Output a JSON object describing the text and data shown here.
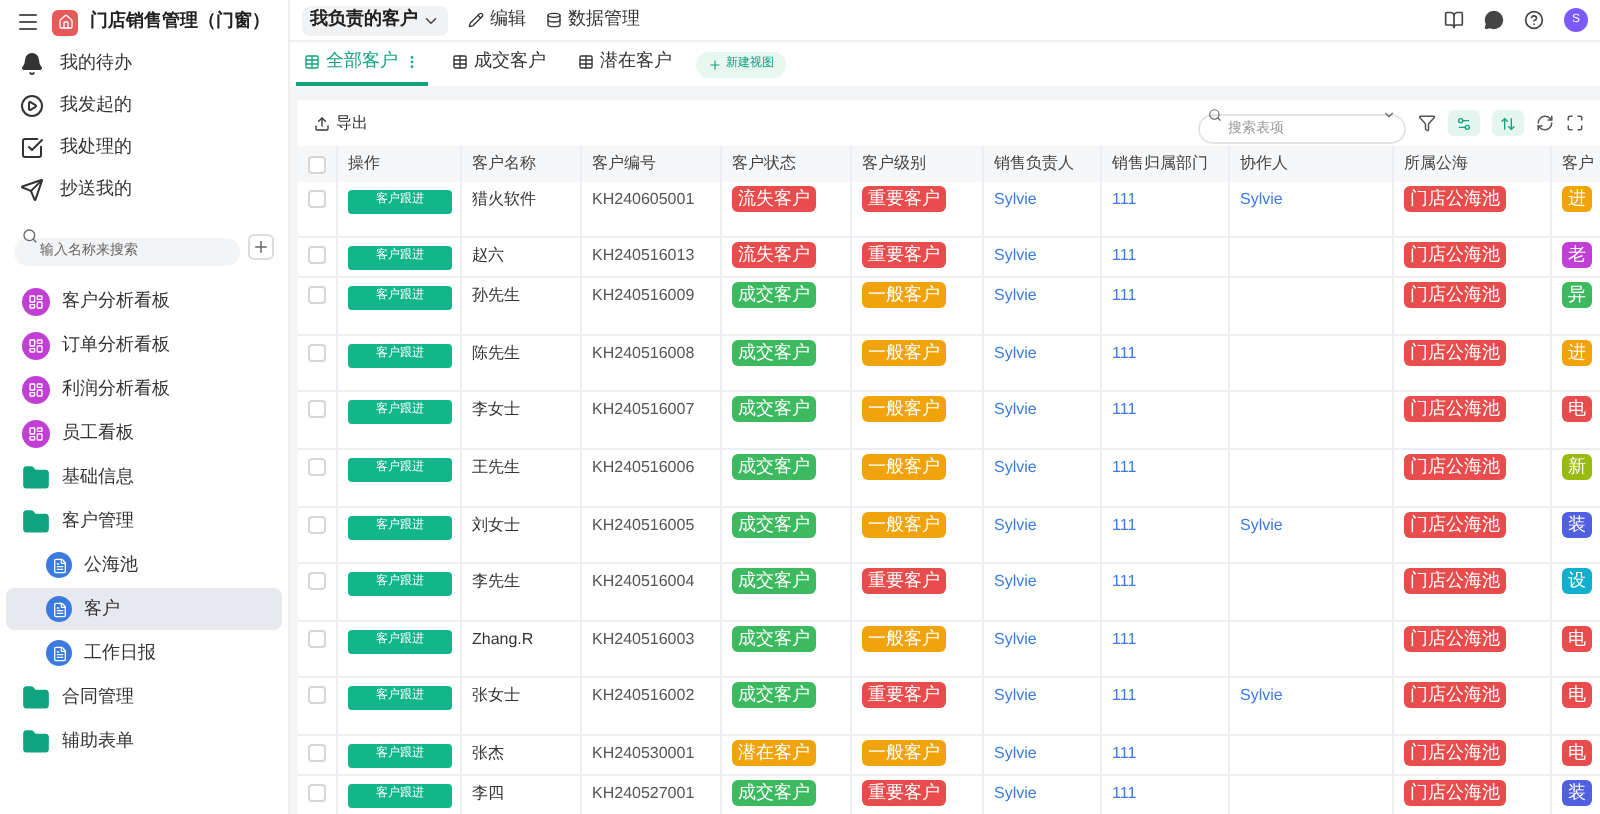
{
  "app": {
    "title": "门店销售管理（门窗）",
    "avatar": "S"
  },
  "topbar": {
    "view_select": "我负责的客户",
    "actions": [
      {
        "label": "编辑",
        "kind": "edit"
      },
      {
        "label": "数据管理",
        "kind": "data"
      }
    ]
  },
  "sidebar": {
    "shortcuts": [
      {
        "label": "我的待办",
        "kind": "bell"
      },
      {
        "label": "我发起的",
        "kind": "play"
      },
      {
        "label": "我处理的",
        "kind": "check"
      },
      {
        "label": "抄送我的",
        "kind": "send"
      }
    ],
    "search": {
      "placeholder": "输入名称来搜索"
    },
    "items": [
      {
        "label": "客户分析看板",
        "kind": "board",
        "selected": false
      },
      {
        "label": "订单分析看板",
        "kind": "board",
        "selected": false
      },
      {
        "label": "利润分析看板",
        "kind": "board",
        "selected": false
      },
      {
        "label": "员工看板",
        "kind": "board",
        "selected": false
      },
      {
        "label": "基础信息",
        "kind": "folder",
        "selected": false
      },
      {
        "label": "客户管理",
        "kind": "folder",
        "selected": false,
        "children": [
          {
            "label": "公海池",
            "kind": "form",
            "selected": false
          },
          {
            "label": "客户",
            "kind": "form",
            "selected": true
          },
          {
            "label": "工作日报",
            "kind": "form",
            "selected": false
          }
        ]
      },
      {
        "label": "合同管理",
        "kind": "folder",
        "selected": false
      },
      {
        "label": "辅助表单",
        "kind": "folder",
        "selected": false
      }
    ]
  },
  "tabs": [
    {
      "label": "全部客户",
      "selected": true
    },
    {
      "label": "成交客户",
      "selected": false
    },
    {
      "label": "潜在客户",
      "selected": false
    }
  ],
  "new_view_button": "新建视图",
  "toolbar": {
    "export": "导出",
    "search": {
      "placeholder": "搜索表项"
    }
  },
  "table": {
    "columns": [
      "操作",
      "客户名称",
      "客户编号",
      "客户状态",
      "客户级别",
      "销售负责人",
      "销售归属部门",
      "协作人",
      "所属公海",
      "客户"
    ],
    "select_all_checked": false,
    "rows": [
      {
        "action": "客户跟进",
        "name": "猎火软件",
        "code": "KH240605001",
        "status": {
          "text": "流失客户",
          "color": "#e84c4c"
        },
        "level": {
          "text": "重要客户",
          "color": "#e84c4c"
        },
        "owner": "Sylvie",
        "dept": "111",
        "collaborator": "Sylvie",
        "pool": "门店公海池",
        "source": {
          "text": "进",
          "color": "#f0a30a"
        },
        "checked": false
      },
      {
        "action": "客户跟进",
        "name": "赵六",
        "code": "KH240516013",
        "status": {
          "text": "流失客户",
          "color": "#e84c4c"
        },
        "level": {
          "text": "重要客户",
          "color": "#e84c4c"
        },
        "owner": "Sylvie",
        "dept": "111",
        "pool": "门店公海池",
        "source": {
          "text": "老",
          "color": "#c23fd6"
        },
        "checked": false
      },
      {
        "action": "客户跟进",
        "name": "孙先生",
        "code": "KH240516009",
        "status": {
          "text": "成交客户",
          "color": "#3dba5f"
        },
        "level": {
          "text": "一般客户",
          "color": "#f0a30a"
        },
        "owner": "Sylvie",
        "dept": "111",
        "pool": "门店公海池",
        "source": {
          "text": "异",
          "color": "#3dba5f"
        },
        "checked": false
      },
      {
        "action": "客户跟进",
        "name": "陈先生",
        "code": "KH240516008",
        "status": {
          "text": "成交客户",
          "color": "#3dba5f"
        },
        "level": {
          "text": "一般客户",
          "color": "#f0a30a"
        },
        "owner": "Sylvie",
        "dept": "111",
        "pool": "门店公海池",
        "source": {
          "text": "进",
          "color": "#f0a30a"
        },
        "checked": false
      },
      {
        "action": "客户跟进",
        "name": "李女士",
        "code": "KH240516007",
        "status": {
          "text": "成交客户",
          "color": "#3dba5f"
        },
        "level": {
          "text": "一般客户",
          "color": "#f0a30a"
        },
        "owner": "Sylvie",
        "dept": "111",
        "pool": "门店公海池",
        "source": {
          "text": "电",
          "color": "#e84c4c"
        },
        "checked": false
      },
      {
        "action": "客户跟进",
        "name": "王先生",
        "code": "KH240516006",
        "status": {
          "text": "成交客户",
          "color": "#3dba5f"
        },
        "level": {
          "text": "一般客户",
          "color": "#f0a30a"
        },
        "owner": "Sylvie",
        "dept": "111",
        "pool": "门店公海池",
        "source": {
          "text": "新",
          "color": "#99bb10"
        },
        "checked": false
      },
      {
        "action": "客户跟进",
        "name": "刘女士",
        "code": "KH240516005",
        "status": {
          "text": "成交客户",
          "color": "#3dba5f"
        },
        "level": {
          "text": "一般客户",
          "color": "#f0a30a"
        },
        "owner": "Sylvie",
        "dept": "111",
        "collaborator": "Sylvie",
        "pool": "门店公海池",
        "source": {
          "text": "装",
          "color": "#5160e0"
        },
        "checked": false
      },
      {
        "action": "客户跟进",
        "name": "李先生",
        "code": "KH240516004",
        "status": {
          "text": "成交客户",
          "color": "#3dba5f"
        },
        "level": {
          "text": "重要客户",
          "color": "#e84c4c"
        },
        "owner": "Sylvie",
        "dept": "111",
        "pool": "门店公海池",
        "source": {
          "text": "设",
          "color": "#12aed0"
        },
        "checked": false
      },
      {
        "action": "客户跟进",
        "name": "Zhang.R",
        "code": "KH240516003",
        "status": {
          "text": "成交客户",
          "color": "#3dba5f"
        },
        "level": {
          "text": "一般客户",
          "color": "#f0a30a"
        },
        "owner": "Sylvie",
        "dept": "111",
        "pool": "门店公海池",
        "source": {
          "text": "电",
          "color": "#e84c4c"
        },
        "checked": false
      },
      {
        "action": "客户跟进",
        "name": "张女士",
        "code": "KH240516002",
        "status": {
          "text": "成交客户",
          "color": "#3dba5f"
        },
        "level": {
          "text": "重要客户",
          "color": "#e84c4c"
        },
        "owner": "Sylvie",
        "dept": "111",
        "collaborator": "Sylvie",
        "pool": "门店公海池",
        "source": {
          "text": "电",
          "color": "#e84c4c"
        },
        "checked": false
      },
      {
        "action": "客户跟进",
        "name": "张杰",
        "code": "KH240530001",
        "status": {
          "text": "潜在客户",
          "color": "#f0a30a"
        },
        "level": {
          "text": "一般客户",
          "color": "#f0a30a"
        },
        "owner": "Sylvie",
        "dept": "111",
        "pool": "门店公海池",
        "source": {
          "text": "电",
          "color": "#e84c4c"
        },
        "checked": false
      },
      {
        "action": "客户跟进",
        "name": "李四",
        "code": "KH240527001",
        "status": {
          "text": "成交客户",
          "color": "#3dba5f"
        },
        "level": {
          "text": "重要客户",
          "color": "#e84c4c"
        },
        "owner": "Sylvie",
        "dept": "111",
        "pool": "门店公海池",
        "source": {
          "text": "装",
          "color": "#5160e0"
        },
        "checked": false
      }
    ]
  }
}
